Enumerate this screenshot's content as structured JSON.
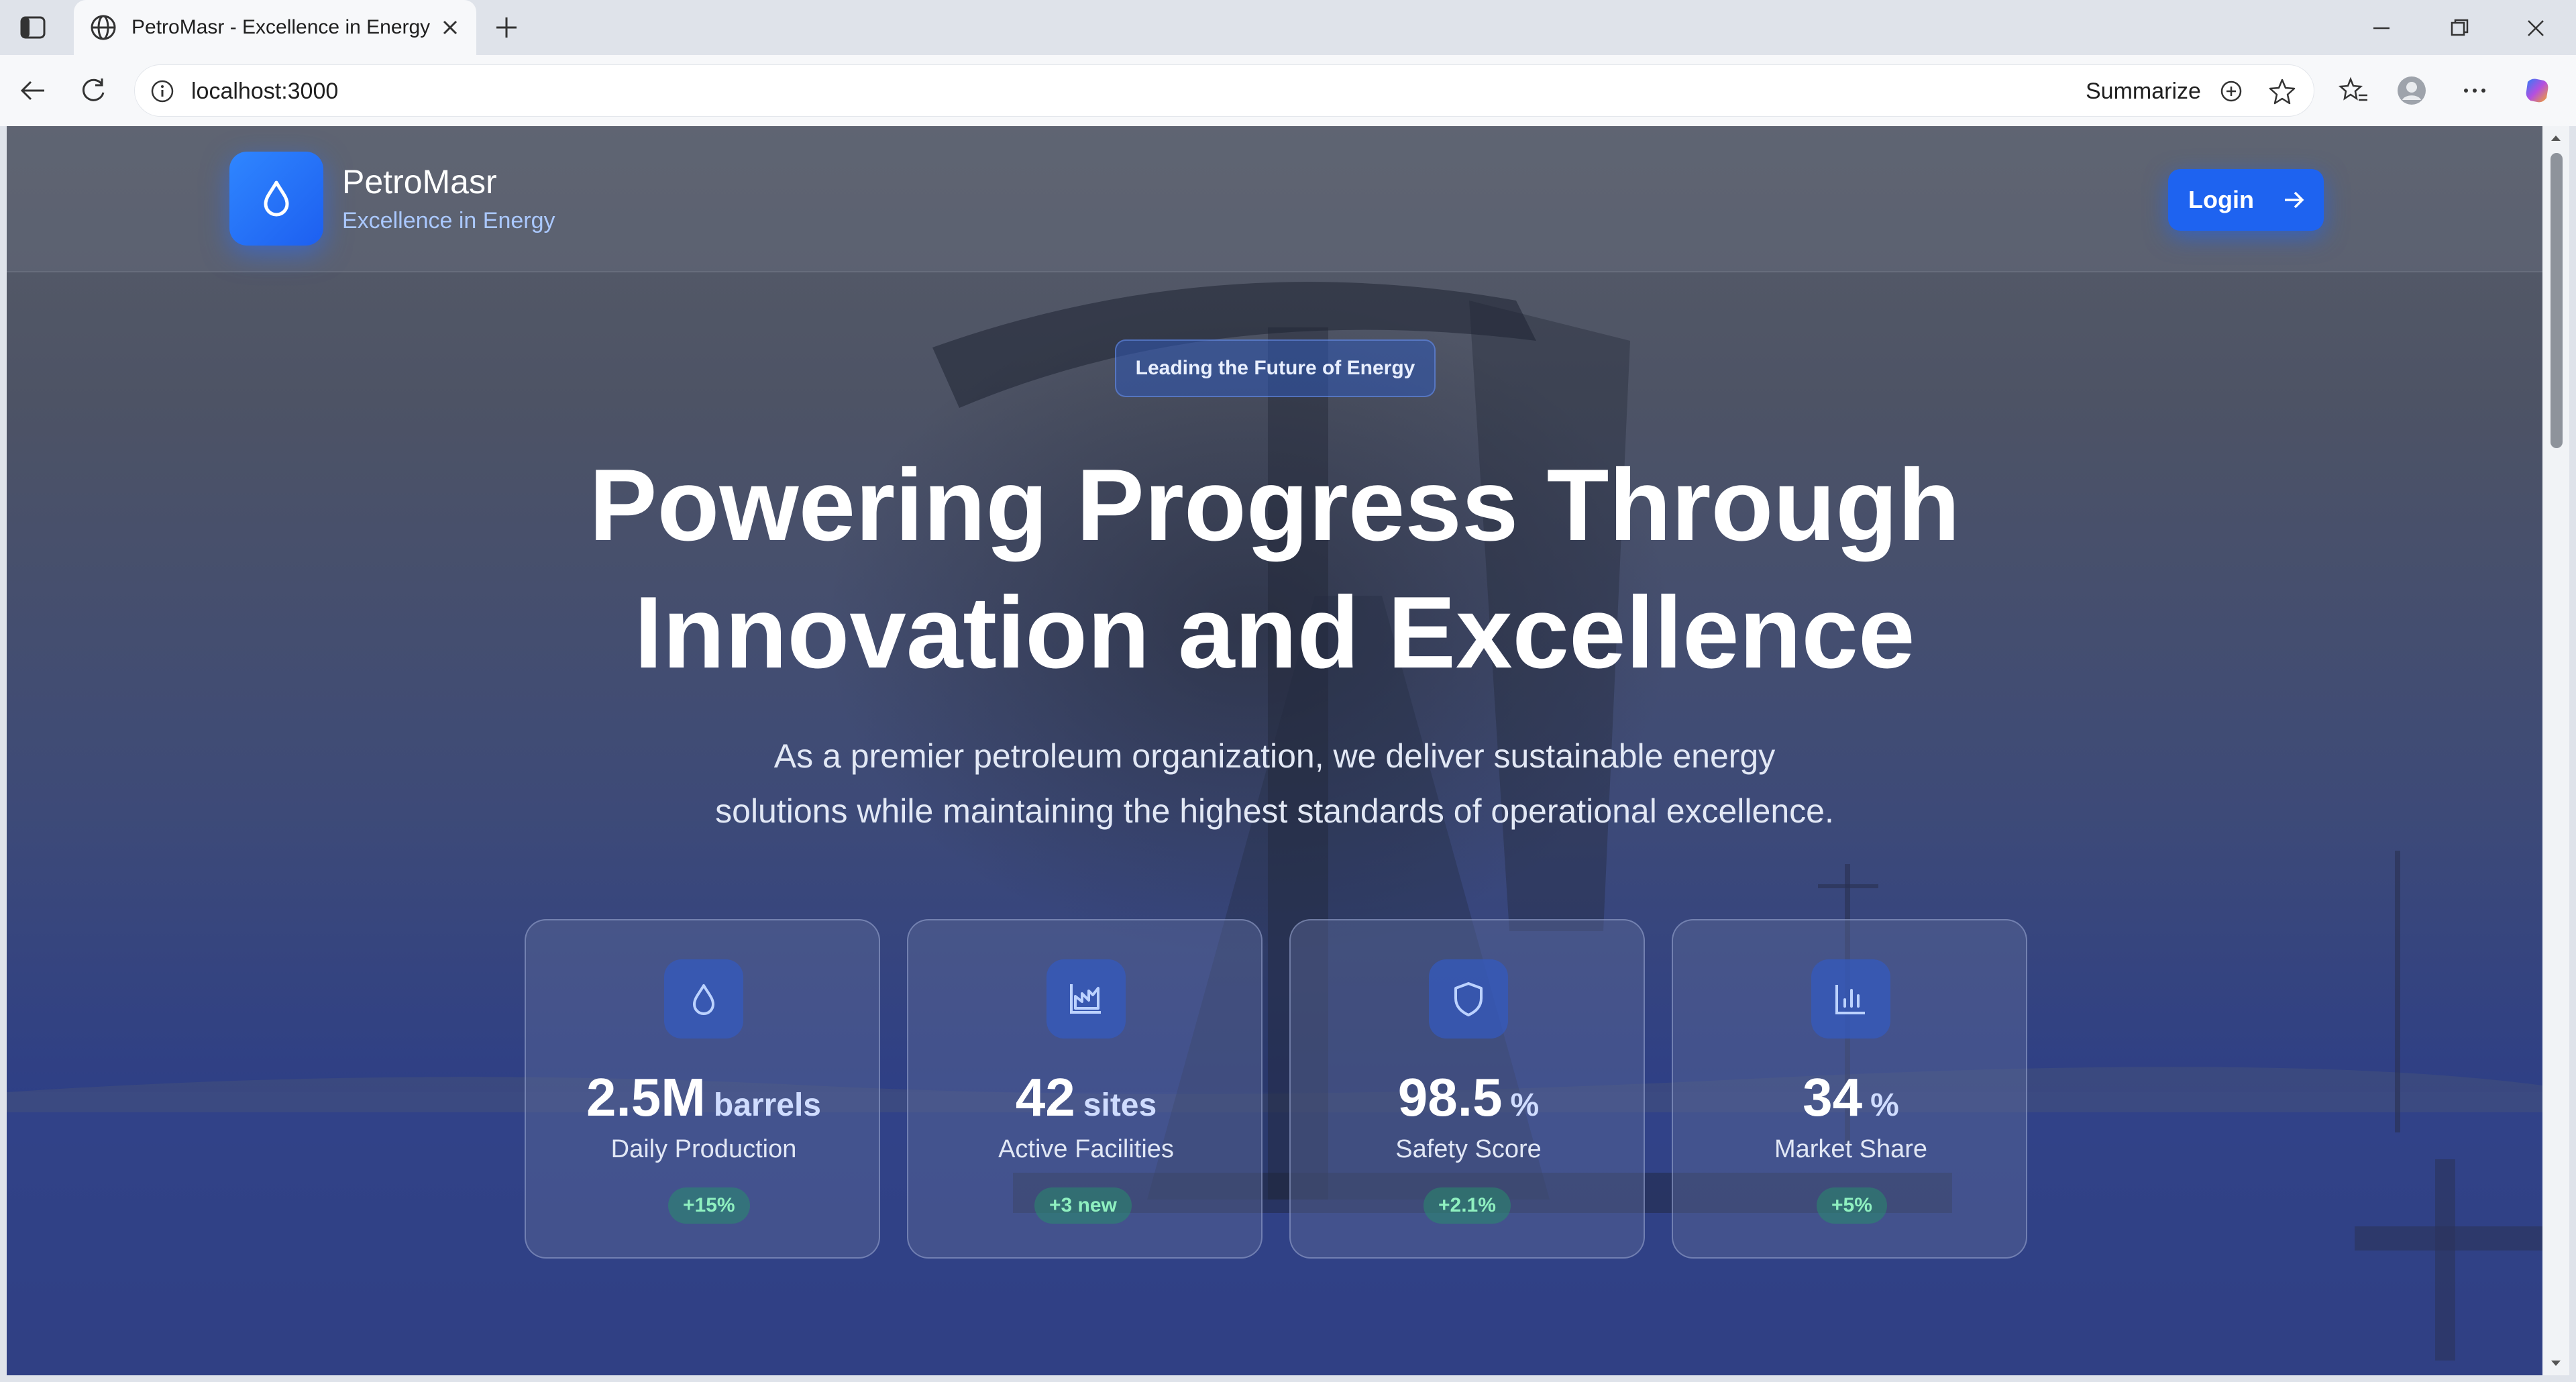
{
  "browser": {
    "tab_title": "PetroMasr - Excellence in Energy",
    "url": "localhost:3000",
    "summarize_label": "Summarize"
  },
  "header": {
    "brand_name": "PetroMasr",
    "brand_tagline": "Excellence in Energy",
    "login_label": "Login"
  },
  "hero": {
    "pill": "Leading the Future of Energy",
    "headline_line1": "Powering Progress Through",
    "headline_line2": "Innovation and Excellence",
    "sub_line1": "As a premier petroleum organization, we deliver sustainable energy",
    "sub_line2": "solutions while maintaining the highest standards of operational excellence."
  },
  "stats": [
    {
      "icon": "droplet-icon",
      "value": "2.5M",
      "unit": "barrels",
      "label": "Daily Production",
      "delta": "+15%"
    },
    {
      "icon": "factory-icon",
      "value": "42",
      "unit": "sites",
      "label": "Active Facilities",
      "delta": "+3 new"
    },
    {
      "icon": "shield-icon",
      "value": "98.5",
      "unit": "%",
      "label": "Safety Score",
      "delta": "+2.1%"
    },
    {
      "icon": "bar-chart-icon",
      "value": "34",
      "unit": "%",
      "label": "Market Share",
      "delta": "+5%"
    }
  ],
  "colors": {
    "accent": "#1e63f0",
    "delta_text": "#8ff0c0"
  }
}
